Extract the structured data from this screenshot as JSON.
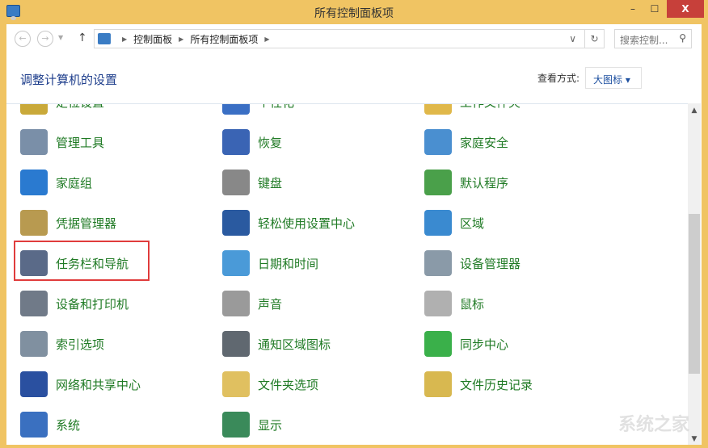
{
  "window": {
    "title": "所有控制面板项",
    "min": "–",
    "max": "☐",
    "close": "X"
  },
  "address": {
    "back": "←",
    "forward": "→",
    "up": "↑",
    "crumbs": [
      "控制面板",
      "所有控制面板项"
    ],
    "dropdown": "∨",
    "refresh": "↻"
  },
  "search": {
    "placeholder": "搜索控制...",
    "icon": "search-icon"
  },
  "header": {
    "title": "调整计算机的设置",
    "view_label": "查看方式:",
    "view_value": "大图标 ▾"
  },
  "items": [
    {
      "label": "定位设置",
      "color": "#c9a93a"
    },
    {
      "label": "个性化",
      "color": "#3a6fc4"
    },
    {
      "label": "工作文件夹",
      "color": "#e0b84a"
    },
    {
      "label": "管理工具",
      "color": "#7a8fa8"
    },
    {
      "label": "恢复",
      "color": "#3a64b4"
    },
    {
      "label": "家庭安全",
      "color": "#4a8fd0"
    },
    {
      "label": "家庭组",
      "color": "#2a7ad0"
    },
    {
      "label": "键盘",
      "color": "#888888"
    },
    {
      "label": "默认程序",
      "color": "#4aa04a"
    },
    {
      "label": "凭据管理器",
      "color": "#b89a50"
    },
    {
      "label": "轻松使用设置中心",
      "color": "#2a5aa0"
    },
    {
      "label": "区域",
      "color": "#3a8ad0"
    },
    {
      "label": "任务栏和导航",
      "color": "#5a6a88"
    },
    {
      "label": "日期和时间",
      "color": "#4a9ad8"
    },
    {
      "label": "设备管理器",
      "color": "#8a9aa8"
    },
    {
      "label": "设备和打印机",
      "color": "#707a88"
    },
    {
      "label": "声音",
      "color": "#9a9a9a"
    },
    {
      "label": "鼠标",
      "color": "#b0b0b0"
    },
    {
      "label": "索引选项",
      "color": "#8090a0"
    },
    {
      "label": "通知区域图标",
      "color": "#606870"
    },
    {
      "label": "同步中心",
      "color": "#3ab04a"
    },
    {
      "label": "网络和共享中心",
      "color": "#2a50a0"
    },
    {
      "label": "文件夹选项",
      "color": "#e0c060"
    },
    {
      "label": "文件历史记录",
      "color": "#d8b850"
    },
    {
      "label": "系统",
      "color": "#3a70c0"
    },
    {
      "label": "显示",
      "color": "#3a8a5a"
    }
  ],
  "watermark": "系统之家"
}
